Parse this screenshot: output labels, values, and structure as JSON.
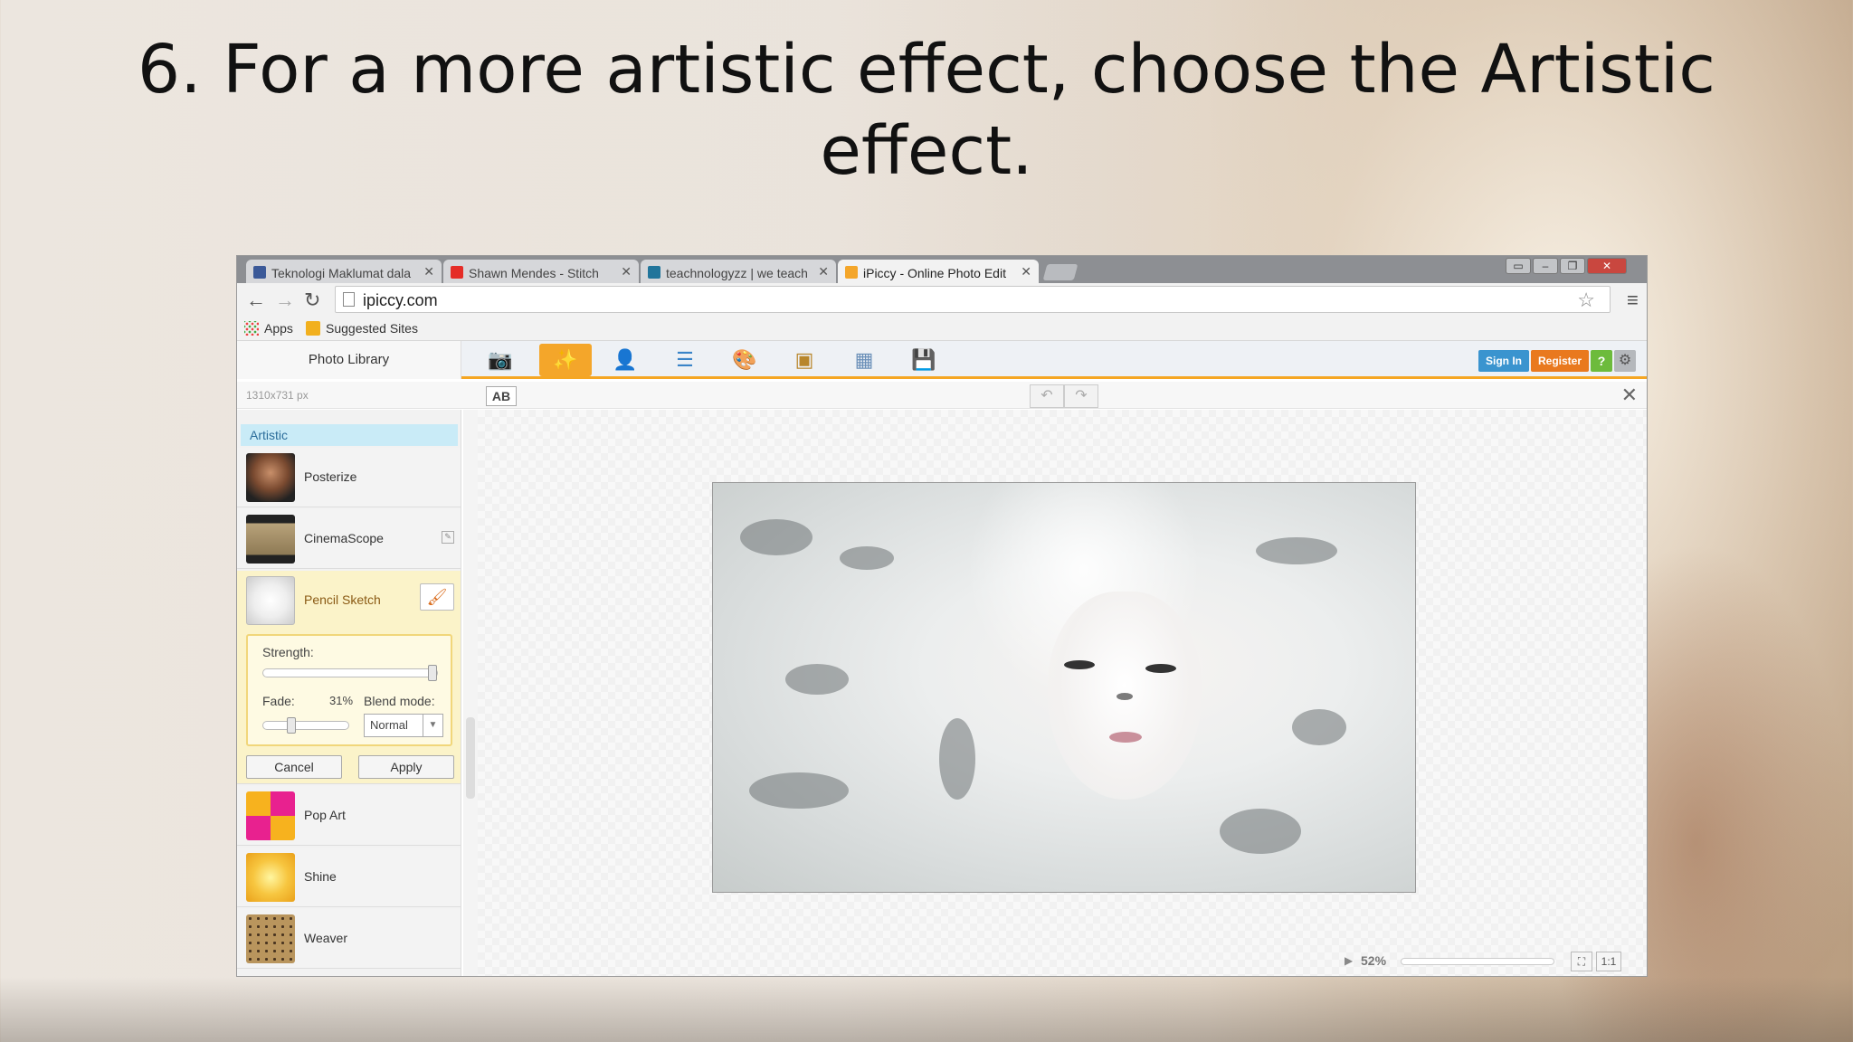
{
  "slide": {
    "title_line1": "6. For a more artistic effect, choose the Artistic",
    "title_line2": "effect."
  },
  "browser": {
    "tabs": [
      {
        "label": "Teknologi Maklumat dala",
        "icon": "facebook-icon",
        "color": "#3b5998"
      },
      {
        "label": "Shawn Mendes - Stitch",
        "icon": "youtube-icon",
        "color": "#e52d27"
      },
      {
        "label": "teachnologyzz | we teach",
        "icon": "wordpress-icon",
        "color": "#21759b"
      },
      {
        "label": "iPiccy - Online Photo Edit",
        "icon": "ipiccy-icon",
        "color": "#f4a62a"
      }
    ],
    "url": "ipiccy.com",
    "bookmarks": [
      {
        "label": "Apps",
        "icon": "apps-grid-icon"
      },
      {
        "label": "Suggested Sites",
        "icon": "bing-icon"
      }
    ]
  },
  "app": {
    "photo_library": "Photo Library",
    "tools": [
      "camera-icon",
      "magic-wand-icon",
      "portrait-icon",
      "layers-icon",
      "art-palette-icon",
      "frame-icon",
      "texture-icon",
      "save-icon"
    ],
    "sign_in": "Sign In",
    "register": "Register",
    "help": "?",
    "dimensions": "1310x731 px",
    "ab_label": "AB"
  },
  "effects": {
    "section": "Artistic",
    "items": [
      {
        "label": "Posterize"
      },
      {
        "label": "CinemaScope"
      },
      {
        "label": "Pencil Sketch"
      },
      {
        "label": "Pop Art"
      },
      {
        "label": "Shine"
      },
      {
        "label": "Weaver"
      }
    ],
    "settings": {
      "strength_label": "Strength:",
      "strength_value": 1.0,
      "fade_label": "Fade:",
      "fade_value": "31%",
      "fade_fraction": 0.31,
      "blend_label": "Blend mode:",
      "blend_value": "Normal",
      "cancel": "Cancel",
      "apply": "Apply"
    }
  },
  "canvas": {
    "zoom": "52%",
    "one_to_one": "1:1"
  },
  "colors": {
    "accent": "#f5a623",
    "section_bg": "#c9ebf7",
    "signin": "#3a94cf",
    "register": "#e9791e",
    "help": "#6dbb3c"
  }
}
